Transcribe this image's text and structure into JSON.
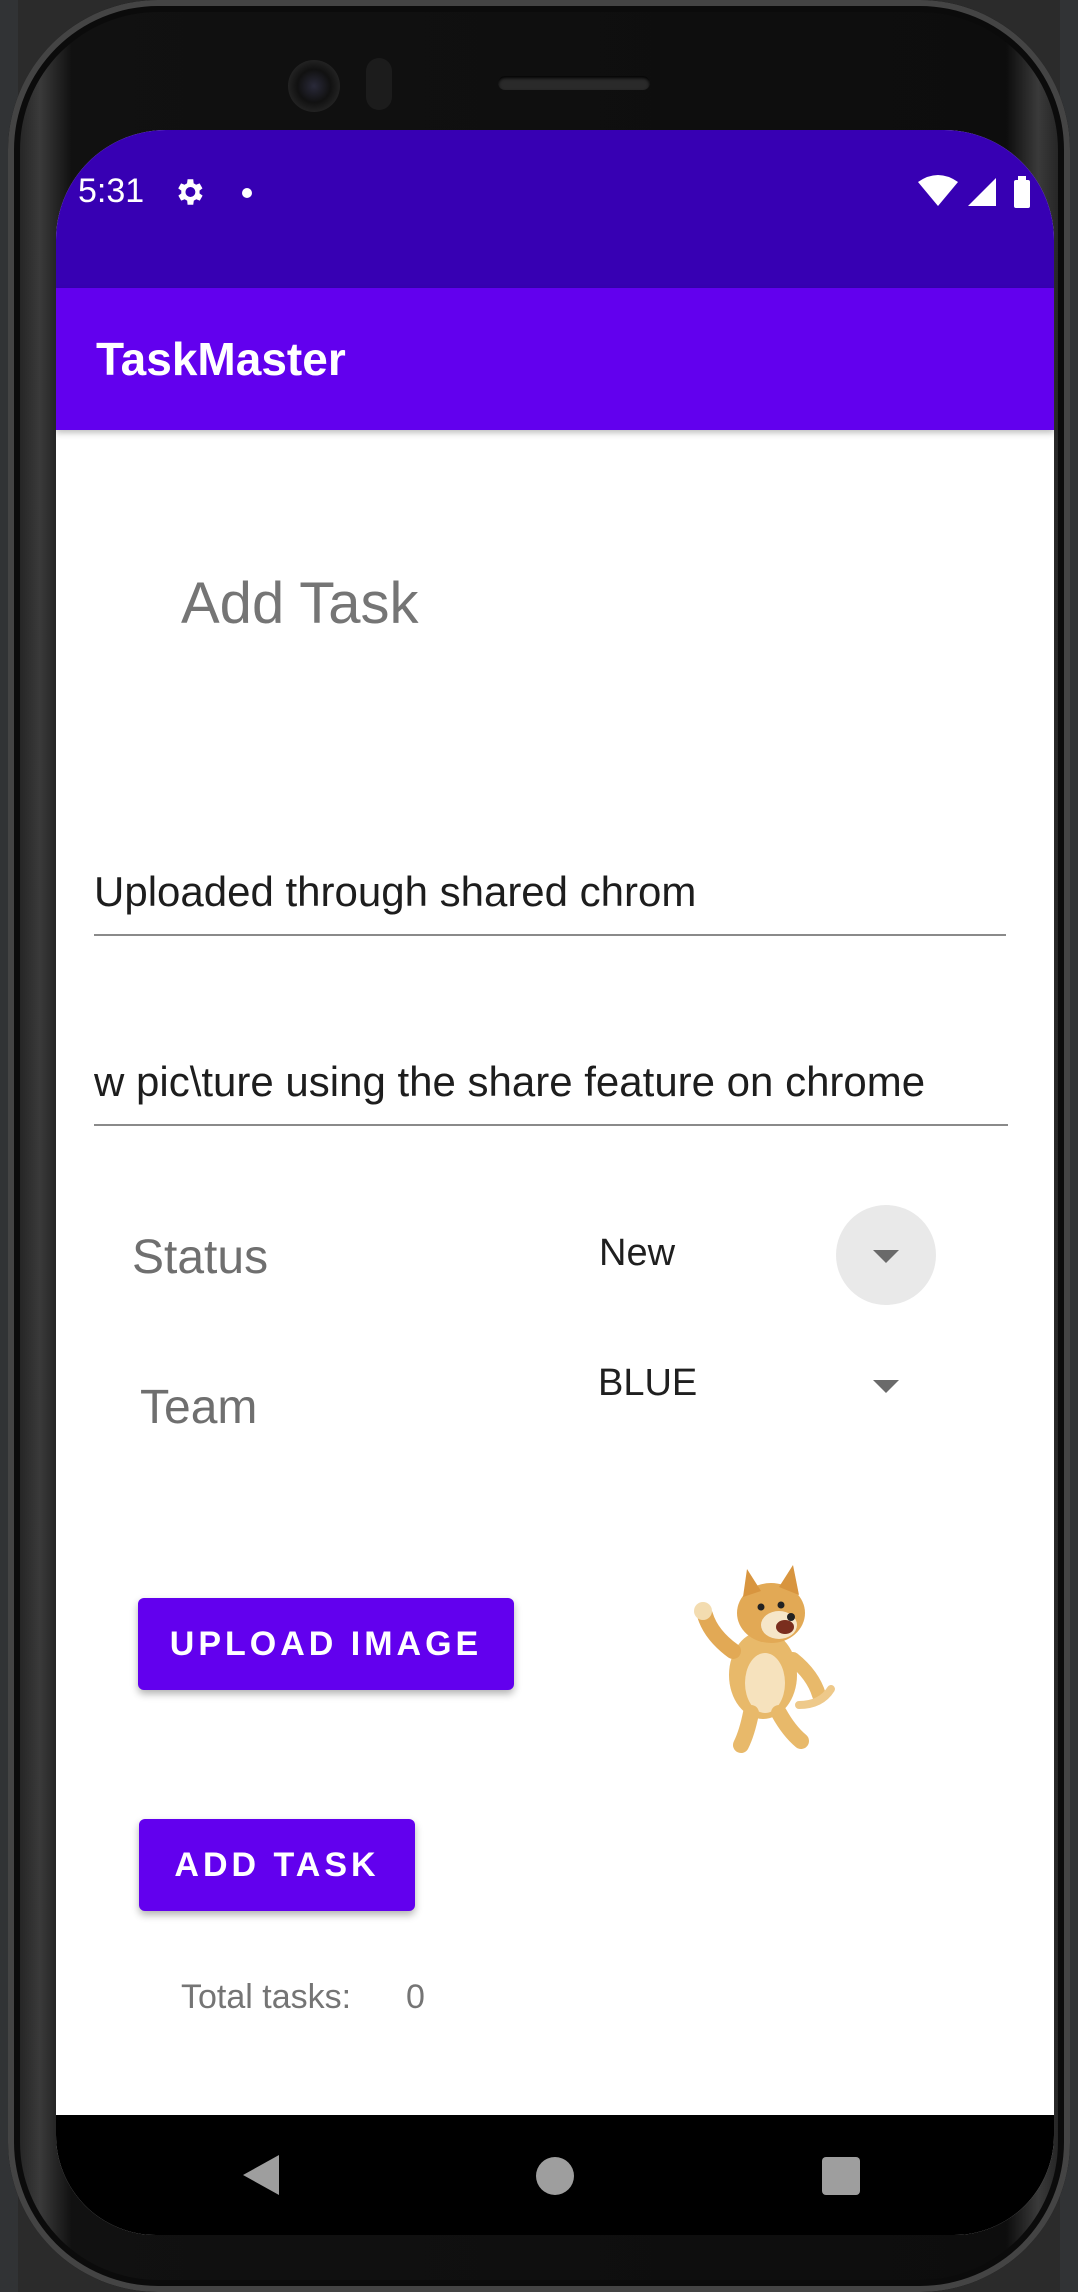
{
  "status_bar": {
    "time": "5:31",
    "icons": [
      "gear-icon",
      "notification-dot-icon",
      "wifi-icon",
      "signal-icon",
      "battery-icon"
    ]
  },
  "app_bar": {
    "title": "TaskMaster"
  },
  "main": {
    "heading": "Add Task",
    "title_field": {
      "value": "Uploaded through shared  chrom"
    },
    "description_field": {
      "value": "w pic\\ture using the share feature on chrome"
    },
    "status": {
      "label": "Status",
      "selected": "New"
    },
    "team": {
      "label": "Team",
      "selected": "BLUE"
    },
    "upload_button": "UPLOAD IMAGE",
    "add_button": "ADD TASK",
    "total": {
      "label": "Total tasks:",
      "value": "0"
    }
  },
  "colors": {
    "status_bar": "#3700b3",
    "app_bar": "#6200ee",
    "button": "#6200ee"
  },
  "nav_bar": {
    "icons": [
      "back-icon",
      "home-icon",
      "recents-icon"
    ]
  }
}
